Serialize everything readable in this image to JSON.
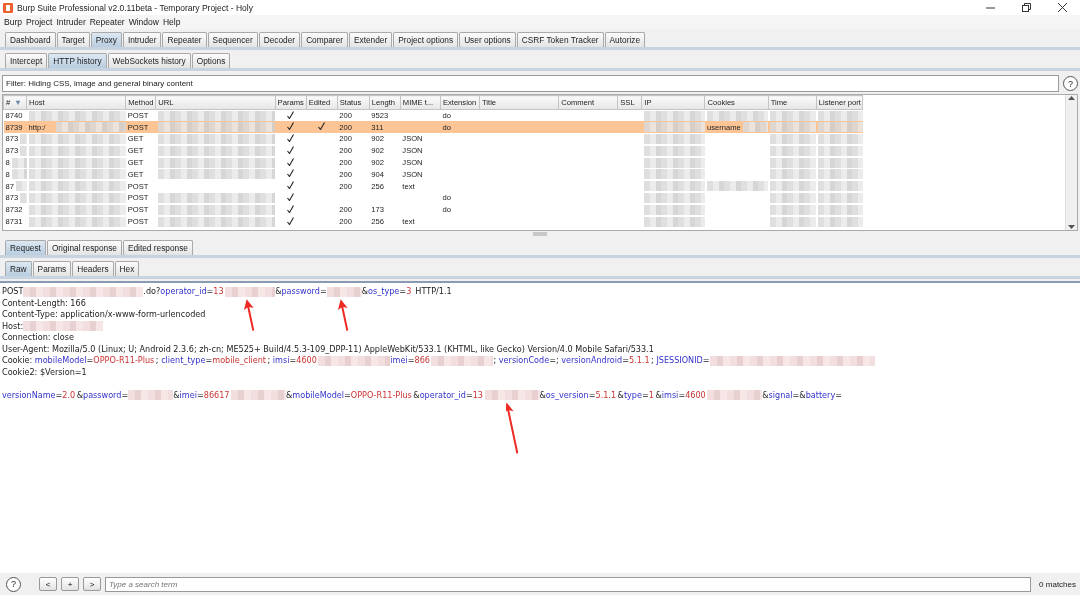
{
  "window": {
    "title": "Burp Suite Professional v2.0.11beta - Temporary Project - Holy"
  },
  "menu": [
    "Burp",
    "Project",
    "Intruder",
    "Repeater",
    "Window",
    "Help"
  ],
  "main_tabs": [
    {
      "label": "Dashboard",
      "selected": false
    },
    {
      "label": "Target",
      "selected": false
    },
    {
      "label": "Proxy",
      "selected": true
    },
    {
      "label": "Intruder",
      "selected": false
    },
    {
      "label": "Repeater",
      "selected": false
    },
    {
      "label": "Sequencer",
      "selected": false
    },
    {
      "label": "Decoder",
      "selected": false
    },
    {
      "label": "Comparer",
      "selected": false
    },
    {
      "label": "Extender",
      "selected": false
    },
    {
      "label": "Project options",
      "selected": false
    },
    {
      "label": "User options",
      "selected": false
    },
    {
      "label": "CSRF Token Tracker",
      "selected": false
    },
    {
      "label": "Autorize",
      "selected": false
    }
  ],
  "proxy_tabs": [
    {
      "label": "Intercept",
      "selected": false
    },
    {
      "label": "HTTP history",
      "selected": true
    },
    {
      "label": "WebSockets history",
      "selected": false
    },
    {
      "label": "Options",
      "selected": false
    }
  ],
  "filter": {
    "text": "Filter: Hiding CSS, image and general binary content",
    "help": "?"
  },
  "table": {
    "columns": [
      "#",
      "Host",
      "Method",
      "URL",
      "Params",
      "Edited",
      "Status",
      "Length",
      "MIME t...",
      "Extension",
      "Title",
      "Comment",
      "SSL",
      "IP",
      "Cookies",
      "Time",
      "Listener port"
    ],
    "sort_mark": "▼",
    "rows": [
      {
        "selected": false,
        "cells": [
          {
            "kind": "text",
            "text": "8740"
          },
          {
            "kind": "text",
            "redacted": true
          },
          {
            "kind": "text",
            "text": "POST"
          },
          {
            "kind": "text",
            "redacted": true
          },
          {
            "kind": "check",
            "checked": true
          },
          {
            "kind": "check",
            "checked": false
          },
          {
            "kind": "text",
            "text": "200"
          },
          {
            "kind": "text",
            "text": "9523"
          },
          {
            "kind": "text"
          },
          {
            "kind": "text",
            "text": "do"
          },
          {
            "kind": "text"
          },
          {
            "kind": "text"
          },
          {
            "kind": "text"
          },
          {
            "kind": "text",
            "redacted": true
          },
          {
            "kind": "text",
            "redacted": true
          },
          {
            "kind": "text",
            "redacted": true
          },
          {
            "kind": "text",
            "redacted": true
          }
        ]
      },
      {
        "selected": true,
        "cells": [
          {
            "kind": "text",
            "text": "8739"
          },
          {
            "kind": "text",
            "text": "http:/",
            "redacted": true
          },
          {
            "kind": "text",
            "text": "POST"
          },
          {
            "kind": "text",
            "redacted": true
          },
          {
            "kind": "check",
            "checked": true
          },
          {
            "kind": "check",
            "checked": true
          },
          {
            "kind": "text",
            "text": "200"
          },
          {
            "kind": "text",
            "text": "311"
          },
          {
            "kind": "text"
          },
          {
            "kind": "text",
            "text": "do"
          },
          {
            "kind": "text"
          },
          {
            "kind": "text"
          },
          {
            "kind": "text"
          },
          {
            "kind": "text",
            "redacted": true
          },
          {
            "kind": "text",
            "text": "username",
            "redacted": true
          },
          {
            "kind": "text",
            "redacted": true
          },
          {
            "kind": "text",
            "redacted": true
          }
        ]
      },
      {
        "selected": false,
        "cells": [
          {
            "kind": "text",
            "text": "873",
            "redacted": true
          },
          {
            "kind": "text",
            "redacted": true
          },
          {
            "kind": "text",
            "text": "GET"
          },
          {
            "kind": "text",
            "redacted": true
          },
          {
            "kind": "check",
            "checked": true
          },
          {
            "kind": "check",
            "checked": false
          },
          {
            "kind": "text",
            "text": "200"
          },
          {
            "kind": "text",
            "text": "902"
          },
          {
            "kind": "text",
            "text": "JSON"
          },
          {
            "kind": "text"
          },
          {
            "kind": "text"
          },
          {
            "kind": "text"
          },
          {
            "kind": "text"
          },
          {
            "kind": "text",
            "redacted": true
          },
          {
            "kind": "text"
          },
          {
            "kind": "text",
            "redacted": true
          },
          {
            "kind": "text",
            "redacted": true
          }
        ]
      },
      {
        "selected": false,
        "cells": [
          {
            "kind": "text",
            "text": "873",
            "redacted": true
          },
          {
            "kind": "text",
            "redacted": true
          },
          {
            "kind": "text",
            "text": "GET"
          },
          {
            "kind": "text",
            "redacted": true
          },
          {
            "kind": "check",
            "checked": true
          },
          {
            "kind": "check",
            "checked": false
          },
          {
            "kind": "text",
            "text": "200"
          },
          {
            "kind": "text",
            "text": "902"
          },
          {
            "kind": "text",
            "text": "JSON"
          },
          {
            "kind": "text"
          },
          {
            "kind": "text"
          },
          {
            "kind": "text"
          },
          {
            "kind": "text"
          },
          {
            "kind": "text",
            "redacted": true
          },
          {
            "kind": "text"
          },
          {
            "kind": "text",
            "redacted": true
          },
          {
            "kind": "text",
            "redacted": true
          }
        ]
      },
      {
        "selected": false,
        "cells": [
          {
            "kind": "text",
            "text": "8",
            "redacted": true
          },
          {
            "kind": "text",
            "redacted": true
          },
          {
            "kind": "text",
            "text": "GET"
          },
          {
            "kind": "text",
            "redacted": true
          },
          {
            "kind": "check",
            "checked": true
          },
          {
            "kind": "check",
            "checked": false
          },
          {
            "kind": "text",
            "text": "200"
          },
          {
            "kind": "text",
            "text": "902"
          },
          {
            "kind": "text",
            "text": "JSON"
          },
          {
            "kind": "text"
          },
          {
            "kind": "text"
          },
          {
            "kind": "text"
          },
          {
            "kind": "text"
          },
          {
            "kind": "text",
            "redacted": true
          },
          {
            "kind": "text"
          },
          {
            "kind": "text",
            "redacted": true
          },
          {
            "kind": "text",
            "redacted": true
          }
        ]
      },
      {
        "selected": false,
        "cells": [
          {
            "kind": "text",
            "text": "8",
            "redacted": true
          },
          {
            "kind": "text",
            "redacted": true
          },
          {
            "kind": "text",
            "text": "GET"
          },
          {
            "kind": "text",
            "redacted": true
          },
          {
            "kind": "check",
            "checked": true
          },
          {
            "kind": "check",
            "checked": false
          },
          {
            "kind": "text",
            "text": "200"
          },
          {
            "kind": "text",
            "text": "904"
          },
          {
            "kind": "text",
            "text": "JSON"
          },
          {
            "kind": "text"
          },
          {
            "kind": "text"
          },
          {
            "kind": "text"
          },
          {
            "kind": "text"
          },
          {
            "kind": "text",
            "redacted": true
          },
          {
            "kind": "text"
          },
          {
            "kind": "text",
            "redacted": true
          },
          {
            "kind": "text",
            "redacted": true
          }
        ]
      },
      {
        "selected": false,
        "cells": [
          {
            "kind": "text",
            "text": "87",
            "redacted": true
          },
          {
            "kind": "text",
            "redacted": true
          },
          {
            "kind": "text",
            "text": "POST"
          },
          {
            "kind": "text"
          },
          {
            "kind": "check",
            "checked": true
          },
          {
            "kind": "check",
            "checked": false
          },
          {
            "kind": "text",
            "text": "200"
          },
          {
            "kind": "text",
            "text": "256"
          },
          {
            "kind": "text",
            "text": "text"
          },
          {
            "kind": "text"
          },
          {
            "kind": "text"
          },
          {
            "kind": "text"
          },
          {
            "kind": "text"
          },
          {
            "kind": "text",
            "redacted": true
          },
          {
            "kind": "text",
            "redacted": true
          },
          {
            "kind": "text",
            "redacted": true
          },
          {
            "kind": "text",
            "redacted": true
          }
        ]
      },
      {
        "selected": false,
        "cells": [
          {
            "kind": "text",
            "text": "873",
            "redacted": true
          },
          {
            "kind": "text",
            "redacted": true
          },
          {
            "kind": "text",
            "text": "POST"
          },
          {
            "kind": "text",
            "redacted": true
          },
          {
            "kind": "check",
            "checked": true
          },
          {
            "kind": "check",
            "checked": false
          },
          {
            "kind": "text"
          },
          {
            "kind": "text"
          },
          {
            "kind": "text"
          },
          {
            "kind": "text",
            "text": "do"
          },
          {
            "kind": "text"
          },
          {
            "kind": "text"
          },
          {
            "kind": "text"
          },
          {
            "kind": "text",
            "redacted": true
          },
          {
            "kind": "text"
          },
          {
            "kind": "text",
            "redacted": true
          },
          {
            "kind": "text",
            "redacted": true
          }
        ]
      },
      {
        "selected": false,
        "cells": [
          {
            "kind": "text",
            "text": "8732"
          },
          {
            "kind": "text",
            "redacted": true
          },
          {
            "kind": "text",
            "text": "POST"
          },
          {
            "kind": "text",
            "redacted": true
          },
          {
            "kind": "check",
            "checked": true
          },
          {
            "kind": "check",
            "checked": false
          },
          {
            "kind": "text",
            "text": "200"
          },
          {
            "kind": "text",
            "text": "173"
          },
          {
            "kind": "text"
          },
          {
            "kind": "text",
            "text": "do"
          },
          {
            "kind": "text"
          },
          {
            "kind": "text"
          },
          {
            "kind": "text"
          },
          {
            "kind": "text",
            "redacted": true
          },
          {
            "kind": "text"
          },
          {
            "kind": "text",
            "redacted": true
          },
          {
            "kind": "text",
            "redacted": true
          }
        ]
      },
      {
        "selected": false,
        "cells": [
          {
            "kind": "text",
            "text": "8731"
          },
          {
            "kind": "text",
            "redacted": true
          },
          {
            "kind": "text",
            "text": "POST"
          },
          {
            "kind": "text",
            "redacted": true
          },
          {
            "kind": "check",
            "checked": true
          },
          {
            "kind": "check",
            "checked": false
          },
          {
            "kind": "text",
            "text": "200"
          },
          {
            "kind": "text",
            "text": "256"
          },
          {
            "kind": "text",
            "text": "text"
          },
          {
            "kind": "text"
          },
          {
            "kind": "text"
          },
          {
            "kind": "text"
          },
          {
            "kind": "text"
          },
          {
            "kind": "text",
            "redacted": true
          },
          {
            "kind": "text"
          },
          {
            "kind": "text",
            "redacted": true
          },
          {
            "kind": "text",
            "redacted": true
          }
        ]
      }
    ]
  },
  "message_tabs": [
    {
      "label": "Request",
      "selected": true
    },
    {
      "label": "Original response",
      "selected": false
    },
    {
      "label": "Edited response",
      "selected": false
    }
  ],
  "view_tabs": [
    {
      "label": "Raw",
      "selected": true
    },
    {
      "label": "Params",
      "selected": false
    },
    {
      "label": "Headers",
      "selected": false
    },
    {
      "label": "Hex",
      "selected": false
    }
  ],
  "request_lines": [
    {
      "kind": "text",
      "segments": [
        {
          "kind": "plain",
          "text": "POST"
        },
        {
          "kind": "redacted"
        },
        {
          "kind": "plain",
          "text": ".do?"
        },
        {
          "kind": "key",
          "text": "operator_id"
        },
        {
          "kind": "plain",
          "text": "="
        },
        {
          "kind": "value",
          "text": "13"
        },
        {
          "kind": "redacted",
          "marked": true
        },
        {
          "kind": "plain",
          "text": "&"
        },
        {
          "kind": "key",
          "text": "password"
        },
        {
          "kind": "plain",
          "text": "="
        },
        {
          "kind": "redacted",
          "marked": true
        },
        {
          "kind": "plain",
          "text": "&"
        },
        {
          "kind": "key",
          "text": "os_type"
        },
        {
          "kind": "plain",
          "text": "="
        },
        {
          "kind": "value",
          "text": "3"
        },
        {
          "kind": "plain",
          "text": " HTTP/1.1"
        }
      ]
    },
    {
      "kind": "text",
      "segments": [
        {
          "kind": "plain",
          "text": "Content-Length: 166"
        }
      ]
    },
    {
      "kind": "text",
      "segments": [
        {
          "kind": "plain",
          "text": "Content-Type: application/x-www-form-urlencoded"
        }
      ]
    },
    {
      "kind": "text",
      "segments": [
        {
          "kind": "plain",
          "text": "Host:"
        },
        {
          "kind": "redacted"
        }
      ]
    },
    {
      "kind": "text",
      "segments": [
        {
          "kind": "plain",
          "text": "Connection: close"
        }
      ]
    },
    {
      "kind": "text",
      "segments": [
        {
          "kind": "plain",
          "text": "User-Agent: Mozilla/5.0 (Linux; U; Android 2.3.6; zh-cn; ME525+ Build/4.5.3-109_DPP-11) AppleWebKit/533.1 (KHTML, like Gecko) Version/4.0 Mobile Safari/533.1"
        }
      ]
    },
    {
      "kind": "text",
      "segments": [
        {
          "kind": "plain",
          "text": "Cookie: "
        },
        {
          "kind": "key",
          "text": "mobileModel"
        },
        {
          "kind": "plain",
          "text": "="
        },
        {
          "kind": "value",
          "text": "OPPO-R11-Plus"
        },
        {
          "kind": "plain",
          "text": "; "
        },
        {
          "kind": "key",
          "text": "client_type"
        },
        {
          "kind": "plain",
          "text": "="
        },
        {
          "kind": "value",
          "text": "mobile_client"
        },
        {
          "kind": "plain",
          "text": "; "
        },
        {
          "kind": "key",
          "text": "imsi"
        },
        {
          "kind": "plain",
          "text": "="
        },
        {
          "kind": "value",
          "text": "4600"
        },
        {
          "kind": "redacted"
        },
        {
          "kind": "key",
          "text": "imei"
        },
        {
          "kind": "plain",
          "text": "="
        },
        {
          "kind": "value",
          "text": "866"
        },
        {
          "kind": "redacted"
        },
        {
          "kind": "plain",
          "text": "; "
        },
        {
          "kind": "key",
          "text": "versionCode"
        },
        {
          "kind": "plain",
          "text": "=; "
        },
        {
          "kind": "key",
          "text": "versionAndroid"
        },
        {
          "kind": "plain",
          "text": "="
        },
        {
          "kind": "value",
          "text": "5.1.1"
        },
        {
          "kind": "plain",
          "text": "; "
        },
        {
          "kind": "key",
          "text": "JSESSIONID"
        },
        {
          "kind": "plain",
          "text": "="
        },
        {
          "kind": "redacted"
        }
      ]
    },
    {
      "kind": "text",
      "segments": [
        {
          "kind": "plain",
          "text": "Cookie2: $Version=1"
        }
      ]
    },
    {
      "kind": "blank"
    },
    {
      "kind": "text",
      "segments": [
        {
          "kind": "key",
          "text": "versionName"
        },
        {
          "kind": "plain",
          "text": "="
        },
        {
          "kind": "value",
          "text": "2.0"
        },
        {
          "kind": "plain",
          "text": "&"
        },
        {
          "kind": "key",
          "text": "password"
        },
        {
          "kind": "plain",
          "text": "="
        },
        {
          "kind": "redacted"
        },
        {
          "kind": "plain",
          "text": "&"
        },
        {
          "kind": "key",
          "text": "imei"
        },
        {
          "kind": "plain",
          "text": "="
        },
        {
          "kind": "value",
          "text": "86617"
        },
        {
          "kind": "redacted"
        },
        {
          "kind": "plain",
          "text": "&"
        },
        {
          "kind": "key",
          "text": "mobileModel"
        },
        {
          "kind": "plain",
          "text": "="
        },
        {
          "kind": "value",
          "text": "OPPO-R11-Plus"
        },
        {
          "kind": "plain",
          "text": "&"
        },
        {
          "kind": "key",
          "text": "operator_id"
        },
        {
          "kind": "plain",
          "text": "="
        },
        {
          "kind": "value",
          "text": "13"
        },
        {
          "kind": "redacted",
          "marked": true,
          "long": true
        },
        {
          "kind": "plain",
          "text": "&"
        },
        {
          "kind": "key",
          "text": "os_version"
        },
        {
          "kind": "plain",
          "text": "="
        },
        {
          "kind": "value",
          "text": "5.1.1"
        },
        {
          "kind": "plain",
          "text": "&"
        },
        {
          "kind": "key",
          "text": "type"
        },
        {
          "kind": "plain",
          "text": "="
        },
        {
          "kind": "value",
          "text": "1"
        },
        {
          "kind": "plain",
          "text": "&"
        },
        {
          "kind": "key",
          "text": "imsi"
        },
        {
          "kind": "plain",
          "text": "="
        },
        {
          "kind": "value",
          "text": "4600"
        },
        {
          "kind": "redacted"
        },
        {
          "kind": "plain",
          "text": "&"
        },
        {
          "kind": "key",
          "text": "signal"
        },
        {
          "kind": "plain",
          "text": "=&"
        },
        {
          "kind": "key",
          "text": "battery"
        },
        {
          "kind": "plain",
          "text": "="
        }
      ]
    }
  ],
  "search_bar": {
    "help": "?",
    "buttons": [
      "<",
      "+",
      ">"
    ],
    "placeholder": "Type a search term",
    "matches": "0 matches"
  }
}
